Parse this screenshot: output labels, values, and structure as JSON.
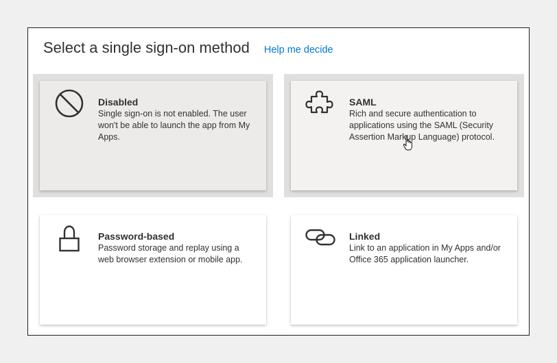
{
  "header": {
    "title": "Select a single sign-on method",
    "help_link": "Help me decide"
  },
  "methods": [
    {
      "name": "Disabled",
      "description": "Single sign-on is not enabled. The user won't be able to launch the app from My Apps.",
      "icon": "prohibited-icon",
      "state": "selected"
    },
    {
      "name": "SAML",
      "description": "Rich and secure authentication to applications using the SAML (Security Assertion Markup Language) protocol.",
      "icon": "puzzle-piece-icon",
      "state": "hover"
    },
    {
      "name": "Password-based",
      "description": "Password storage and replay using a web browser extension or mobile app.",
      "icon": "lock-icon",
      "state": "default"
    },
    {
      "name": "Linked",
      "description": "Link to an application in My Apps and/or Office 365 application launcher.",
      "icon": "link-icon",
      "state": "default"
    }
  ],
  "colors": {
    "accent": "#0078d4",
    "selected_tile": "#edebe9",
    "hover_tile": "#f3f2f1",
    "text": "#323130"
  }
}
